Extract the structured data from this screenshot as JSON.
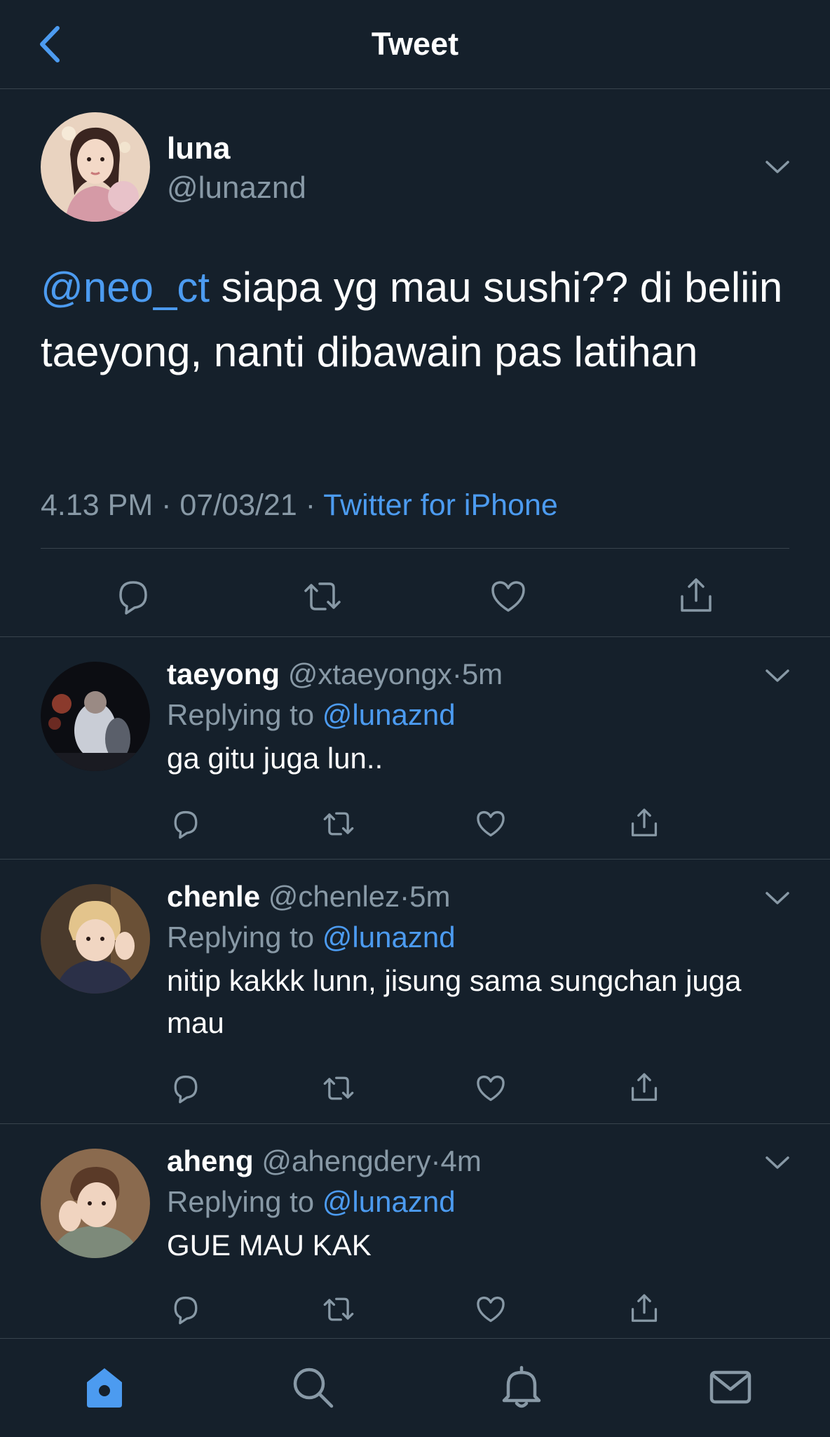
{
  "header": {
    "title": "Tweet"
  },
  "colors": {
    "background": "#15202b",
    "accent": "#4c9bf0",
    "muted": "#8899a6",
    "divider": "#38444d"
  },
  "main_tweet": {
    "name": "luna",
    "handle": "@lunaznd",
    "mention": "@neo_ct",
    "text": " siapa yg mau sushi?? di beliin taeyong, nanti dibawain pas latihan",
    "time": "4.13 PM",
    "date": "07/03/21",
    "separator": "·",
    "source": "Twitter for iPhone",
    "actions": [
      "reply-icon",
      "retweet-icon",
      "like-icon",
      "share-icon"
    ]
  },
  "replies": [
    {
      "name": "taeyong",
      "handle": "@xtaeyongx",
      "dot": "·",
      "time": "5m",
      "replying_prefix": "Replying to ",
      "replying_to": "@lunaznd",
      "text": "ga gitu juga lun.."
    },
    {
      "name": "chenle",
      "handle": "@chenlez",
      "dot": "·",
      "time": "5m",
      "replying_prefix": "Replying to ",
      "replying_to": "@lunaznd",
      "text": "nitip kakkk lunn, jisung sama sungchan juga mau"
    },
    {
      "name": "aheng",
      "handle": "@ahengdery",
      "dot": "·",
      "time": "4m",
      "replying_prefix": "Replying to ",
      "replying_to": "@lunaznd",
      "text": "GUE MAU KAK"
    }
  ],
  "tabbar": [
    "home-icon",
    "search-icon",
    "notifications-icon",
    "messages-icon"
  ]
}
